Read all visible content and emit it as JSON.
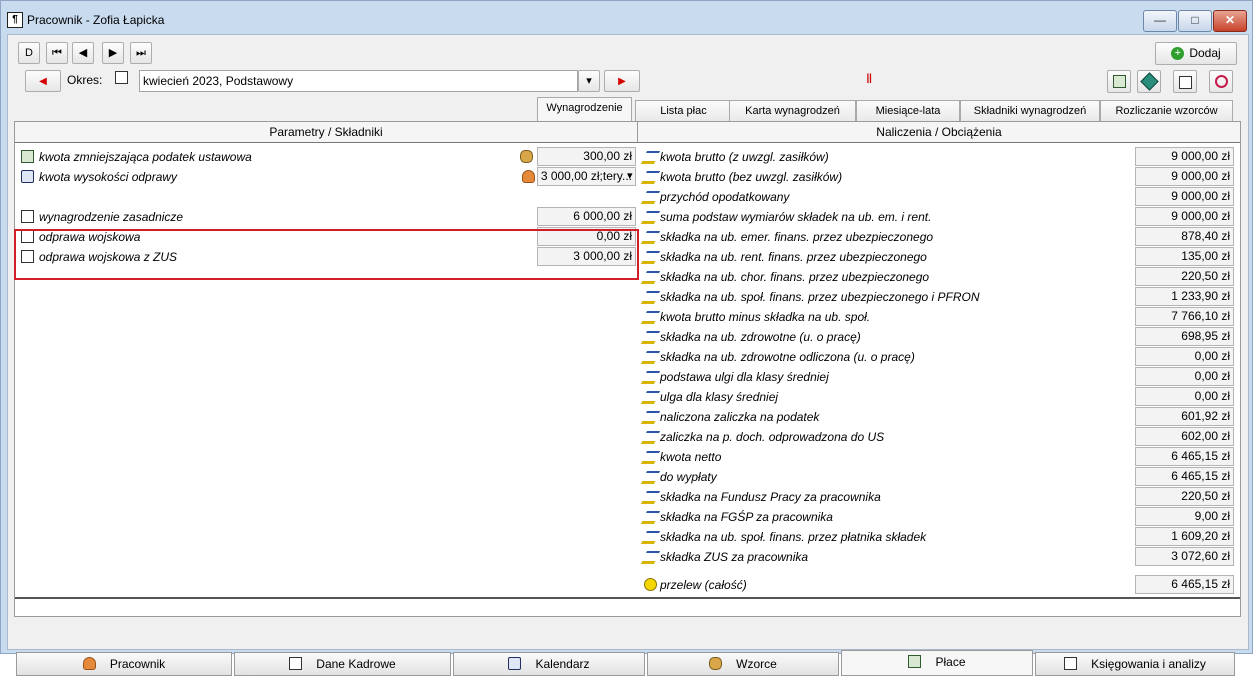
{
  "window": {
    "title": "Pracownik - Zofia Łapicka",
    "min": "—",
    "max": "□",
    "close": "✕"
  },
  "nav": {
    "first_new": "D",
    "first": "⏮",
    "prev": "◀",
    "next": "▶",
    "last": "⏭"
  },
  "period": {
    "label": "Okres:",
    "value": "kwiecień 2023, Podstawowy",
    "dropdown": "▾"
  },
  "toolbar": {
    "add_label": "Dodaj"
  },
  "tabs": [
    "Wynagrodzenie",
    "Lista płac",
    "Karta wynagrodzeń",
    "Miesiące-lata",
    "Składniki wynagrodzeń",
    "Rozliczanie wzorców"
  ],
  "left": {
    "header": "Parametry / Składniki",
    "rows": [
      {
        "label": "kwota zmniejszająca podatek ustawowa",
        "value": "300,00 zł"
      },
      {
        "label": "kwota wysokości odprawy",
        "value": "3 000,00 zł;tery..."
      },
      {
        "label": "wynagrodzenie zasadnicze",
        "value": "6 000,00 zł"
      },
      {
        "label": "odprawa wojskowa",
        "value": "0,00 zł"
      },
      {
        "label": "odprawa wojskowa z ZUS",
        "value": "3 000,00 zł"
      }
    ]
  },
  "right": {
    "header": "Naliczenia / Obciążenia",
    "rows": [
      {
        "label": "kwota brutto (z uwzgl. zasiłków)",
        "value": "9 000,00 zł"
      },
      {
        "label": "kwota brutto (bez uwzgl. zasiłków)",
        "value": "9 000,00 zł"
      },
      {
        "label": "przychód opodatkowany",
        "value": "9 000,00 zł"
      },
      {
        "label": "suma podstaw wymiarów składek na ub. em. i rent.",
        "value": "9 000,00 zł"
      },
      {
        "label": "składka na ub. emer. finans. przez ubezpieczonego",
        "value": "878,40 zł"
      },
      {
        "label": "składka na ub. rent. finans. przez ubezpieczonego",
        "value": "135,00 zł"
      },
      {
        "label": "składka na ub. chor. finans. przez ubezpieczonego",
        "value": "220,50 zł"
      },
      {
        "label": "składka na ub. społ. finans. przez ubezpieczonego i PFRON",
        "value": "1 233,90 zł"
      },
      {
        "label": "kwota brutto minus składka na ub. społ.",
        "value": "7 766,10 zł"
      },
      {
        "label": "składka na ub. zdrowotne (u. o pracę)",
        "value": "698,95 zł"
      },
      {
        "label": "składka na ub. zdrowotne odliczona (u. o pracę)",
        "value": "0,00 zł"
      },
      {
        "label": "podstawa ulgi dla klasy średniej",
        "value": "0,00 zł"
      },
      {
        "label": "ulga dla klasy średniej",
        "value": "0,00 zł"
      },
      {
        "label": "naliczona zaliczka na podatek",
        "value": "601,92 zł"
      },
      {
        "label": "zaliczka na p. doch. odprowadzona do US",
        "value": "602,00 zł"
      },
      {
        "label": "kwota netto",
        "value": "6 465,15 zł"
      },
      {
        "label": "do wypłaty",
        "value": "6 465,15 zł"
      },
      {
        "label": "składka na Fundusz Pracy za pracownika",
        "value": "220,50 zł"
      },
      {
        "label": "składka na FGŚP za pracownika",
        "value": "9,00 zł"
      },
      {
        "label": "składka na ub. społ. finans. przez płatnika składek",
        "value": "1 609,20 zł"
      },
      {
        "label": "składka ZUS za pracownika",
        "value": "3 072,60 zł"
      }
    ],
    "transfer": {
      "label": "przelew (całość)",
      "value": "6 465,15 zł"
    }
  },
  "bottom_tabs": [
    "Pracownik",
    "Dane Kadrowe",
    "Kalendarz",
    "Wzorce",
    "Płace",
    "Księgowania i analizy"
  ],
  "colors": {
    "highlight": "#d01f26",
    "accent_red": "#d40000",
    "add_green": "#2e9e2e"
  }
}
